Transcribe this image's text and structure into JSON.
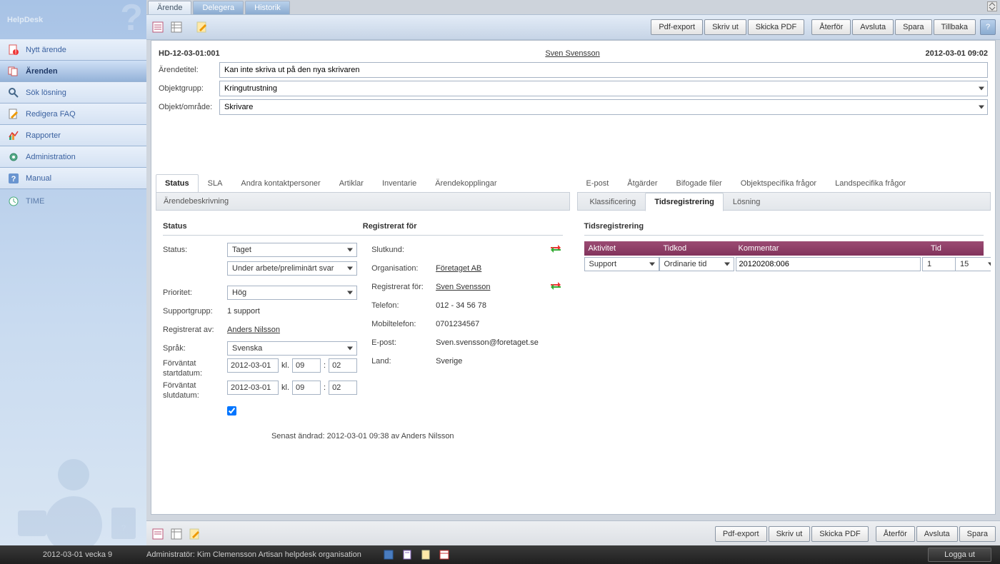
{
  "brand": "HelpDesk",
  "sidebar": {
    "items": [
      {
        "label": "Nytt ärende"
      },
      {
        "label": "Ärenden"
      },
      {
        "label": "Sök lösning"
      },
      {
        "label": "Redigera FAQ"
      },
      {
        "label": "Rapporter"
      },
      {
        "label": "Administration"
      },
      {
        "label": "Manual"
      },
      {
        "label": "TIME"
      }
    ]
  },
  "topTabs": {
    "arende": "Ärende",
    "delegera": "Delegera",
    "historik": "Historik"
  },
  "toolbar": {
    "pdf": "Pdf-export",
    "print": "Skriv ut",
    "sendpdf": "Skicka PDF",
    "aterfor": "Återför",
    "avsluta": "Avsluta",
    "spara": "Spara",
    "tillbaka": "Tillbaka"
  },
  "header": {
    "id": "HD-12-03-01:001",
    "user": "Sven Svensson",
    "timestamp": "2012-03-01 09:02"
  },
  "meta": {
    "titleLabel": "Ärendetitel:",
    "title": "Kan inte skriva ut på den nya skrivaren",
    "groupLabel": "Objektgrupp:",
    "group": "Kringutrustning",
    "areaLabel": "Objekt/område:",
    "area": "Skrivare"
  },
  "leftTabs": {
    "status": "Status",
    "sla": "SLA",
    "kontakt": "Andra kontaktpersoner",
    "artiklar": "Artiklar",
    "inventarie": "Inventarie",
    "kopplingar": "Ärendekopplingar",
    "beskriv": "Ärendebeskrivning"
  },
  "rightTabs": {
    "epost": "E-post",
    "atgarder": "Åtgärder",
    "filer": "Bifogade filer",
    "objekt": "Objektspecifika frågor",
    "land": "Landspecifika frågor",
    "klass": "Klassificering",
    "tids": "Tidsregistrering",
    "losning": "Lösning"
  },
  "status": {
    "headStatus": "Status",
    "headReg": "Registrerat för",
    "statusLabel": "Status:",
    "statusVal": "Taget",
    "substatus": "Under arbete/preliminärt svar",
    "prioLabel": "Prioritet:",
    "prio": "Hög",
    "sgroupLabel": "Supportgrupp:",
    "sgroup": "1 support",
    "regbyLabel": "Registrerat av:",
    "regby": "Anders Nilsson",
    "langLabel": "Språk:",
    "lang": "Svenska",
    "startLabel": "Förväntat startdatum:",
    "startDate": "2012-03-01",
    "startH": "09",
    "startM": "02",
    "endLabel": "Förväntat slutdatum:",
    "endDate": "2012-03-01",
    "endH": "09",
    "endM": "02",
    "kl": "kl.",
    "colon": ":",
    "slutkundLabel": "Slutkund:",
    "orgLabel": "Organisation:",
    "org": "Företaget AB",
    "regforLabel": "Registrerat för:",
    "regfor": "Sven Svensson",
    "telLabel": "Telefon:",
    "tel": "012 - 34 56 78",
    "mobLabel": "Mobiltelefon:",
    "mob": "0701234567",
    "emailLabel": "E-post:",
    "email": "Sven.svensson@foretaget.se",
    "landLabel": "Land:",
    "land": "Sverige",
    "lastChanged": "Senast ändrad: 2012-03-01 09:38 av Anders Nilsson"
  },
  "tids": {
    "title": "Tidsregistrering",
    "cols": {
      "akt": "Aktivitet",
      "kod": "Tidkod",
      "komm": "Kommentar",
      "tid": "Tid"
    },
    "row": {
      "akt": "Support",
      "kod": "Ordinarie tid",
      "komm": "20120208:006",
      "h": "1",
      "m": "15",
      "colon": ":"
    }
  },
  "statusbar": {
    "date": "2012-03-01  vecka 9",
    "admin": "Administratör: Kim Clemensson  Artisan helpdesk organisation",
    "logout": "Logga ut"
  }
}
